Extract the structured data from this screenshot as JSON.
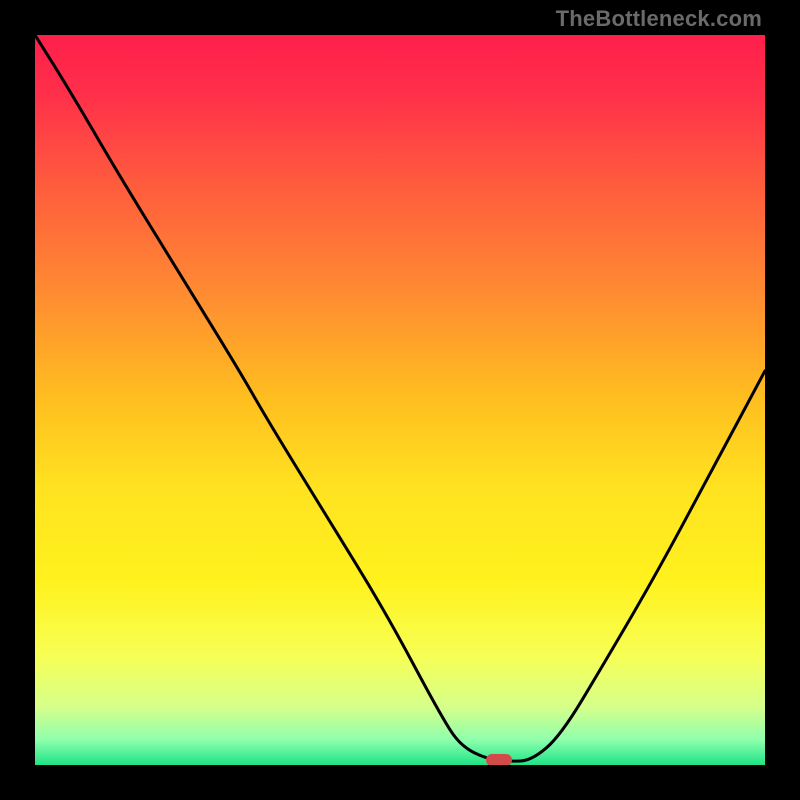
{
  "watermark": "TheBottleneck.com",
  "colors": {
    "black": "#000000",
    "marker": "#d24a4a",
    "curve": "#000000"
  },
  "gradient_stops": [
    {
      "offset": 0,
      "color": "#ff1f4b"
    },
    {
      "offset": 0.08,
      "color": "#ff2f4a"
    },
    {
      "offset": 0.2,
      "color": "#ff5a3e"
    },
    {
      "offset": 0.35,
      "color": "#ff8a32"
    },
    {
      "offset": 0.5,
      "color": "#ffbf20"
    },
    {
      "offset": 0.62,
      "color": "#ffe220"
    },
    {
      "offset": 0.75,
      "color": "#fff21e"
    },
    {
      "offset": 0.85,
      "color": "#f7ff55"
    },
    {
      "offset": 0.92,
      "color": "#d6ff8a"
    },
    {
      "offset": 0.965,
      "color": "#8fffad"
    },
    {
      "offset": 1.0,
      "color": "#1fe487"
    }
  ],
  "chart_data": {
    "type": "line",
    "title": "",
    "xlabel": "",
    "ylabel": "",
    "xlim": [
      0,
      100
    ],
    "ylim": [
      0,
      100
    ],
    "x": [
      0,
      5,
      12,
      20,
      28,
      32,
      40,
      48,
      56,
      58.5,
      62,
      65,
      68,
      72,
      78,
      85,
      92,
      100
    ],
    "y": [
      100,
      92,
      80,
      67,
      54,
      47,
      34,
      21,
      6,
      2.5,
      0.8,
      0.5,
      0.6,
      4,
      14,
      26,
      39,
      54
    ],
    "marker": {
      "x": 63.5,
      "y": 0.7
    },
    "notes": "V-shaped bottleneck curve on rainbow gradient; marker indicates optimal point"
  }
}
